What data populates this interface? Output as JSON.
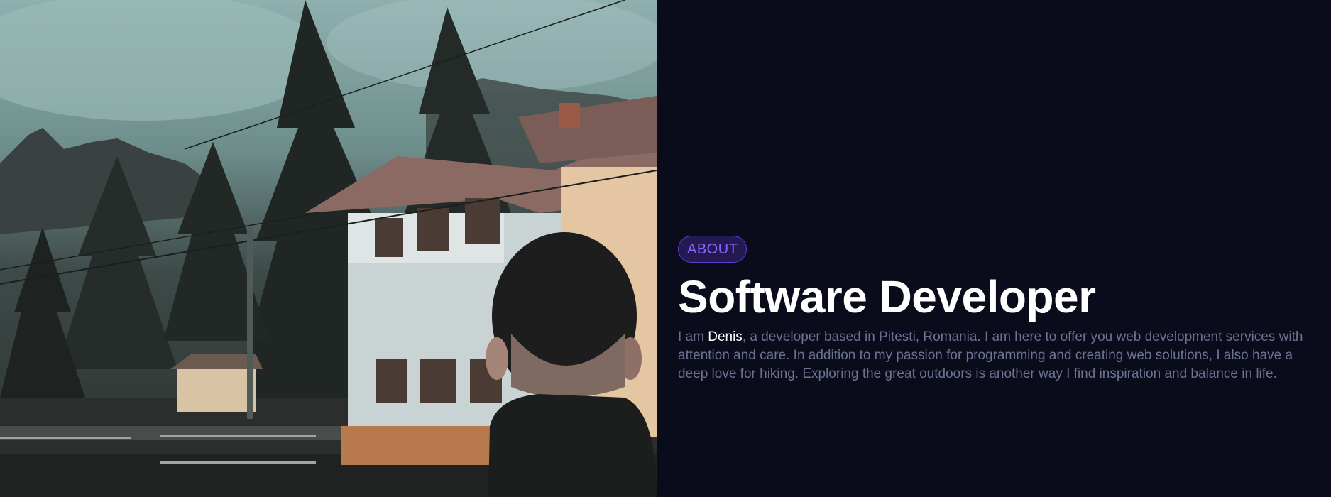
{
  "about": {
    "badge": "ABOUT",
    "title": "Software Developer",
    "desc_before": "I am ",
    "name": "Denis",
    "desc_after": ", a developer based in Pitesti, Romania. I am here to offer you web development services with attention and care. In addition to my passion for programming and creating web solutions, I also have a deep love for hiking. Exploring the great outdoors is another way I find inspiration and balance in life."
  },
  "colors": {
    "background": "#0a0c1c",
    "accent": "#8a64ff",
    "badge_bg": "#231a52",
    "title": "#ffffff",
    "text": "#6c7392"
  }
}
